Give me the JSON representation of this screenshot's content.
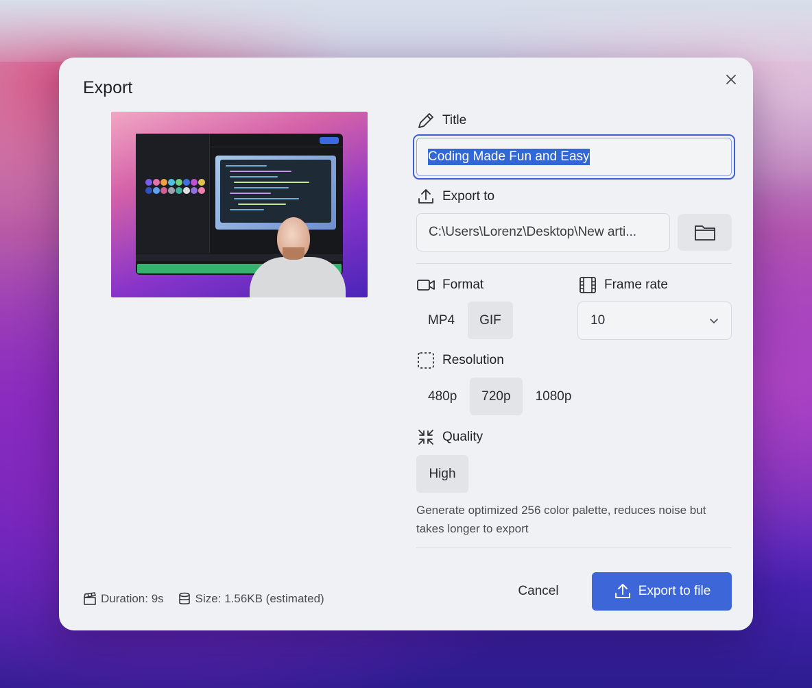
{
  "dialog": {
    "title": "Export"
  },
  "fields": {
    "title_label": "Title",
    "title_value": "Coding Made Fun and Easy",
    "export_to_label": "Export to",
    "export_path": "C:\\Users\\Lorenz\\Desktop\\New arti...",
    "format_label": "Format",
    "format_options": [
      "MP4",
      "GIF"
    ],
    "format_selected": "GIF",
    "frame_rate_label": "Frame rate",
    "frame_rate_value": "10",
    "resolution_label": "Resolution",
    "resolution_options": [
      "480p",
      "720p",
      "1080p"
    ],
    "resolution_selected": "720p",
    "quality_label": "Quality",
    "quality_value": "High",
    "quality_description": "Generate optimized 256 color palette, reduces noise but takes longer to export"
  },
  "footer": {
    "duration": "Duration: 9s",
    "size": "Size: 1.56KB (estimated)",
    "cancel_label": "Cancel",
    "export_label": "Export to file"
  },
  "colors": {
    "accent": "#3d67d8",
    "selection": "#3267d6",
    "dialog_bg": "#f0f1f4"
  },
  "icons": {
    "close": "close-icon",
    "title": "pencil-icon",
    "export_to": "upload-icon",
    "folder": "folder-icon",
    "format": "video-camera-icon",
    "frame_rate": "film-icon",
    "resolution": "dashed-square-icon",
    "quality": "compress-icon",
    "duration": "clapperboard-icon",
    "size": "database-icon",
    "export_button": "upload-icon"
  }
}
